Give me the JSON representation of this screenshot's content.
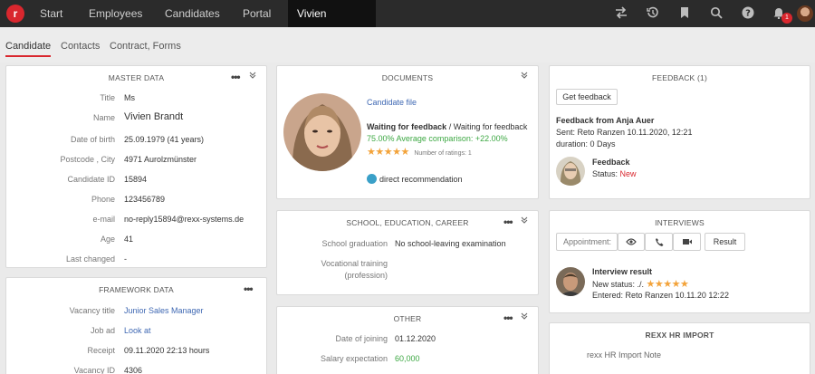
{
  "nav": {
    "logo": "r",
    "items": [
      {
        "label": "Start"
      },
      {
        "label": "Employees"
      },
      {
        "label": "Candidates"
      },
      {
        "label": "Portal"
      }
    ],
    "active_person": "Vivien Brandt",
    "chevron": "⌄",
    "icons": [
      "transfer-icon",
      "history-icon",
      "bookmark-icon",
      "search-icon",
      "help-icon",
      "bell-icon"
    ],
    "notification_count": "1"
  },
  "subtabs": [
    {
      "label": "Candidate",
      "active": true
    },
    {
      "label": "Contacts",
      "active": false
    },
    {
      "label": "Contract, Forms",
      "active": false
    }
  ],
  "master_data": {
    "title": "MASTER DATA",
    "rows": [
      {
        "label": "Title",
        "value": "Ms"
      },
      {
        "label": "Name",
        "value": "Vivien Brandt"
      },
      {
        "label": "Date of birth",
        "value": "25.09.1979 (41 years)"
      },
      {
        "label": "Postcode , City",
        "value": "4971 Aurolzmünster"
      },
      {
        "label": "Candidate ID",
        "value": "15894"
      },
      {
        "label": "Phone",
        "value": "123456789"
      },
      {
        "label": "e-mail",
        "value": "no-reply15894@rexx-systems.de"
      },
      {
        "label": "Age",
        "value": "41"
      },
      {
        "label": "Last changed",
        "value": "-"
      }
    ]
  },
  "framework_data": {
    "title": "FRAMEWORK DATA",
    "rows": [
      {
        "label": "Vacancy title",
        "value": "Junior Sales Manager"
      },
      {
        "label": "Job ad",
        "value": "Look at"
      },
      {
        "label": "Receipt",
        "value": "09.11.2020 22:13 hours"
      },
      {
        "label": "Vacancy ID",
        "value": "4306"
      }
    ]
  },
  "documents": {
    "title": "DOCUMENTS",
    "candidate_file": "Candidate file",
    "status_bold": "Waiting for feedback",
    "status_rest": " / Waiting for feedback",
    "comparison": "75.00% Average comparison: +22.00%",
    "stars": "★★★★★",
    "ratings": "Number of ratings: 1",
    "recommendation": "direct recommendation"
  },
  "school": {
    "title": "SCHOOL, EDUCATION, CAREER",
    "rows": [
      {
        "label": "School graduation",
        "value": "No school-leaving examination"
      },
      {
        "label": "Vocational training (profession)",
        "value": ""
      }
    ]
  },
  "other": {
    "title": "OTHER",
    "rows": [
      {
        "label": "Date of joining",
        "value": "01.12.2020"
      },
      {
        "label": "Salary expectation",
        "value": "60,000"
      }
    ]
  },
  "feedback": {
    "title": "FEEDBACK (1)",
    "get_button": "Get feedback",
    "from": "Feedback from Anja Auer",
    "sent": "Sent: Reto Ranzen 10.11.2020, 12:21",
    "duration": "duration: 0 Days",
    "item_title": "Feedback",
    "status_label": "Status: ",
    "status_value": "New"
  },
  "interviews": {
    "title": "INTERVIEWS",
    "appointment_label": "Appointment:",
    "result_button": "Result",
    "result_title": "Interview result",
    "new_status": "New status: ./.",
    "stars": "★★★★★",
    "entered": "Entered: Reto Ranzen 10.11.20 12:22"
  },
  "hr_import": {
    "title": "REXX HR IMPORT",
    "note": "rexx HR Import Note"
  }
}
